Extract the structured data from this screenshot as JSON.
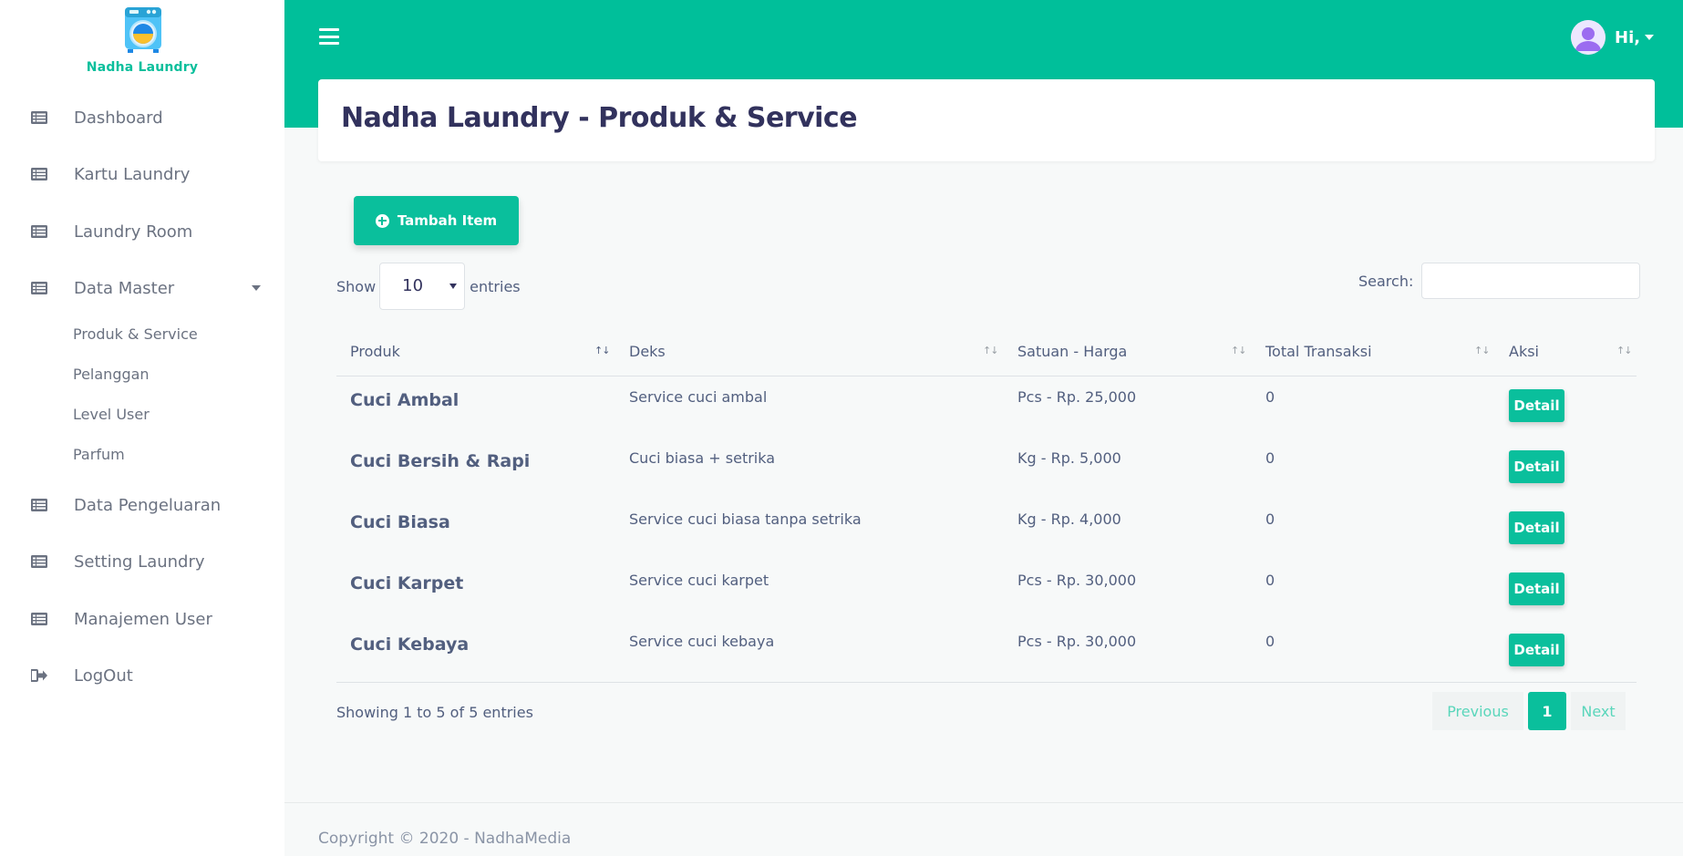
{
  "brand": {
    "name": "Nadha Laundry"
  },
  "sidebar": {
    "items": [
      {
        "label": "Dashboard",
        "icon": "list-icon"
      },
      {
        "label": "Kartu Laundry",
        "icon": "list-icon"
      },
      {
        "label": "Laundry Room",
        "icon": "list-icon"
      },
      {
        "label": "Data Master",
        "icon": "list-icon"
      },
      {
        "label": "Data Pengeluaran",
        "icon": "list-icon"
      },
      {
        "label": "Setting Laundry",
        "icon": "list-icon"
      },
      {
        "label": "Manajemen User",
        "icon": "list-icon"
      },
      {
        "label": "LogOut",
        "icon": "sign-out-icon"
      }
    ],
    "submenu": [
      {
        "label": "Produk & Service"
      },
      {
        "label": "Pelanggan"
      },
      {
        "label": "Level User"
      },
      {
        "label": "Parfum"
      }
    ]
  },
  "topbar": {
    "greeting": "Hi,"
  },
  "page": {
    "title": "Nadha Laundry - Produk & Service"
  },
  "actions": {
    "add_label": "Tambah Item"
  },
  "table_controls": {
    "show_label": "Show",
    "length_value": "10",
    "entries_label": "entries",
    "search_label": "Search:",
    "search_value": ""
  },
  "table": {
    "columns": [
      "Produk",
      "Deks",
      "Satuan - Harga",
      "Total Transaksi",
      "Aksi"
    ],
    "rows": [
      {
        "produk": "Cuci Ambal",
        "deks": "Service cuci ambal",
        "harga": "Pcs - Rp. 25,000",
        "total": "0",
        "aksi": "Detail"
      },
      {
        "produk": "Cuci Bersih & Rapi",
        "deks": "Cuci biasa + setrika",
        "harga": "Kg - Rp. 5,000",
        "total": "0",
        "aksi": "Detail"
      },
      {
        "produk": "Cuci Biasa",
        "deks": "Service cuci biasa tanpa setrika",
        "harga": "Kg - Rp. 4,000",
        "total": "0",
        "aksi": "Detail"
      },
      {
        "produk": "Cuci Karpet",
        "deks": "Service cuci karpet",
        "harga": "Pcs - Rp. 30,000",
        "total": "0",
        "aksi": "Detail"
      },
      {
        "produk": "Cuci Kebaya",
        "deks": "Service cuci kebaya",
        "harga": "Pcs - Rp. 30,000",
        "total": "0",
        "aksi": "Detail"
      }
    ],
    "info": "Showing 1 to 5 of 5 entries"
  },
  "pagination": {
    "previous": "Previous",
    "current": "1",
    "next": "Next"
  },
  "footer": {
    "copyright": "Copyright © 2020 - NadhaMedia"
  },
  "colors": {
    "accent": "#00bf9a",
    "title": "#32325d",
    "text": "#525f7f"
  }
}
